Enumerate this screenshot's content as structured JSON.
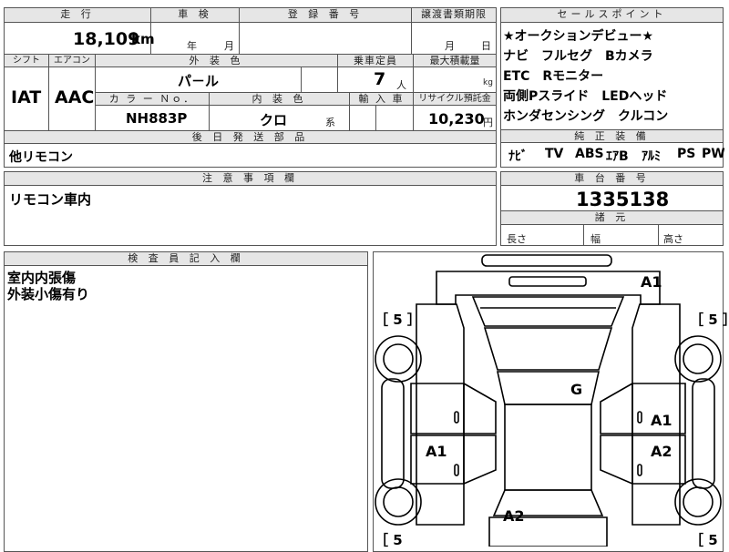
{
  "top": {
    "mileage_label": "走 行",
    "mileage_value": "18,109",
    "mileage_unit": "km",
    "inspection_label": "車 検",
    "inspection_year": "年",
    "inspection_month": "月",
    "registration_label": "登 録 番 号",
    "transfer_label": "譲渡書類期限",
    "transfer_month": "月",
    "transfer_day": "日"
  },
  "row2": {
    "shift_label": "シフト",
    "shift_value": "IAT",
    "ac_label": "エアコン",
    "ac_value": "AAC",
    "exterior_label": "外 装 色",
    "exterior_value": "パ－ル",
    "capacity_label": "乗車定員",
    "capacity_value": "7",
    "capacity_unit": "人",
    "load_label": "最大積載量",
    "load_unit": "kg",
    "color_no_label": "カ ラ ー Ｎｏ．",
    "color_no_value": "NH883P",
    "interior_label": "内 装 色",
    "interior_value": "クロ",
    "interior_unit": "系",
    "import_label": "輸 入 車",
    "recycle_label": "リサイクル預託金",
    "recycle_value": "10,230",
    "recycle_unit": "円"
  },
  "later_parts": {
    "label": "後 日 発 送 部 品",
    "value": "他リモコン"
  },
  "notes": {
    "label": "注 意 事 項 欄",
    "value": "リモコン車内"
  },
  "sales_points": {
    "label": "セールスポイント",
    "items": [
      "★オークションデビュー★",
      "ナビ　フルセグ　Bカメラ",
      "ETC　Rモニター",
      "両側Pスライド　LEDヘッド",
      "ホンダセンシング　クルコン"
    ]
  },
  "equipment": {
    "label": "純 正 装 備",
    "items": [
      "ﾅﾋﾞ",
      "TV",
      "ABS",
      "ｴｱB",
      "ｱﾙﾐ",
      "PS",
      "PW"
    ]
  },
  "chassis": {
    "label": "車 台 番 号",
    "value": "1335138"
  },
  "dimensions": {
    "label": "諸 元",
    "length": "長さ",
    "width": "幅",
    "height": "高さ"
  },
  "inspector": {
    "label": "検 査 員 記 入 欄",
    "lines": [
      "室内内張傷",
      "外装小傷有り"
    ]
  },
  "diagram": {
    "marks": {
      "front_right": "A1",
      "roof": "G",
      "right_front_door": "A1",
      "left_rear_door": "A1",
      "right_rear_door": "A2",
      "rear": "A2"
    },
    "tires": [
      "［ 5 ］",
      "［ 5 ］",
      "［ 5",
      "［ 5"
    ]
  }
}
